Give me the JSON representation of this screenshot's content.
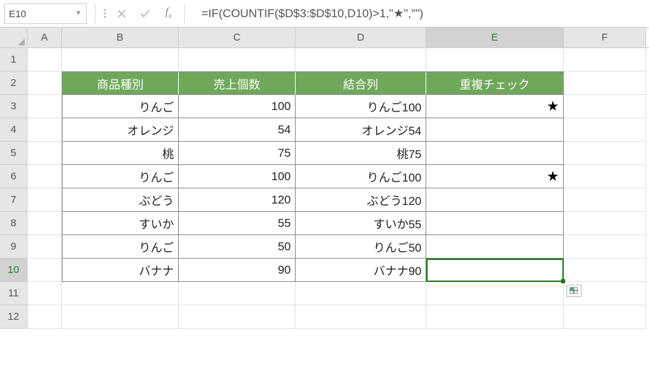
{
  "name_box": "E10",
  "formula": "=IF(COUNTIF($D$3:$D$10,D10)>1,\"★\",\"\")",
  "columns": [
    "A",
    "B",
    "C",
    "D",
    "E",
    "F"
  ],
  "active_col": "E",
  "active_row": 10,
  "table": {
    "headers": [
      "商品種別",
      "売上個数",
      "結合列",
      "重複チェック"
    ],
    "rows": [
      {
        "b": "りんご",
        "c": "100",
        "d": "りんご100",
        "e": "★"
      },
      {
        "b": "オレンジ",
        "c": "54",
        "d": "オレンジ54",
        "e": ""
      },
      {
        "b": "桃",
        "c": "75",
        "d": "桃75",
        "e": ""
      },
      {
        "b": "りんご",
        "c": "100",
        "d": "りんご100",
        "e": "★"
      },
      {
        "b": "ぶどう",
        "c": "120",
        "d": "ぶどう120",
        "e": ""
      },
      {
        "b": "すいか",
        "c": "55",
        "d": "すいか55",
        "e": ""
      },
      {
        "b": "りんご",
        "c": "50",
        "d": "りんご50",
        "e": ""
      },
      {
        "b": "バナナ",
        "c": "90",
        "d": "バナナ90",
        "e": ""
      }
    ]
  },
  "row_count": 12
}
